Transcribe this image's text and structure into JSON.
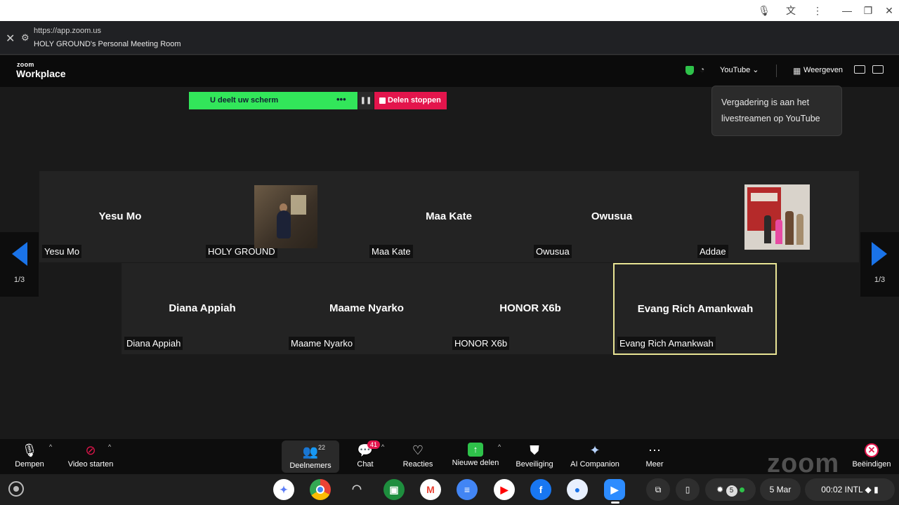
{
  "browser": {
    "url": "https://app.zoom.us",
    "page_title": "HOLY GROUND's Personal Meeting Room"
  },
  "zoom_header": {
    "logo_small": "zoom",
    "logo_big": "Workplace",
    "stream_target": "YouTube",
    "view_label": "Weergeven"
  },
  "share_bar": {
    "status": "U deelt uw scherm",
    "more": "•••",
    "pause": "❚❚",
    "stop": "Delen stoppen"
  },
  "tooltip": {
    "line1": "Vergadering is aan het",
    "line2": "livestreamen op YouTube"
  },
  "pagination": {
    "left_page": "1/3",
    "right_page": "1/3"
  },
  "participants": {
    "row1": [
      {
        "center": "Yesu Mo",
        "tag": "Yesu Mo"
      },
      {
        "center": "",
        "tag": "HOLY GROUND"
      },
      {
        "center": "Maa Kate",
        "tag": "Maa Kate"
      },
      {
        "center": "Owusua",
        "tag": "Owusua"
      },
      {
        "center": "",
        "tag": "Addae"
      }
    ],
    "row2": [
      {
        "center": "Diana Appiah",
        "tag": "Diana Appiah"
      },
      {
        "center": "Maame Nyarko",
        "tag": "Maame Nyarko"
      },
      {
        "center": "HONOR X6b",
        "tag": "HONOR X6b"
      },
      {
        "center": "Evang Rich Amankwah",
        "tag": "Evang Rich Amankwah"
      }
    ]
  },
  "toolbar": {
    "mute": "Dempen",
    "video": "Video starten",
    "participants": "Deelnemers",
    "participants_count": "22",
    "chat": "Chat",
    "chat_badge": "41",
    "reactions": "Reacties",
    "new_share": "Nieuwe delen",
    "security": "Beveiliging",
    "ai": "AI Companion",
    "more": "Meer",
    "end": "Beëindigen",
    "watermark": "zoom"
  },
  "shelf": {
    "notif_count": "5",
    "date": "5 Mar",
    "time": "00:02",
    "locale": "INTL"
  },
  "colors": {
    "share_green": "#32e65a",
    "stop_red": "#e3154c",
    "active_speaker_border": "#e8e494",
    "nav_blue": "#1a73e8"
  }
}
